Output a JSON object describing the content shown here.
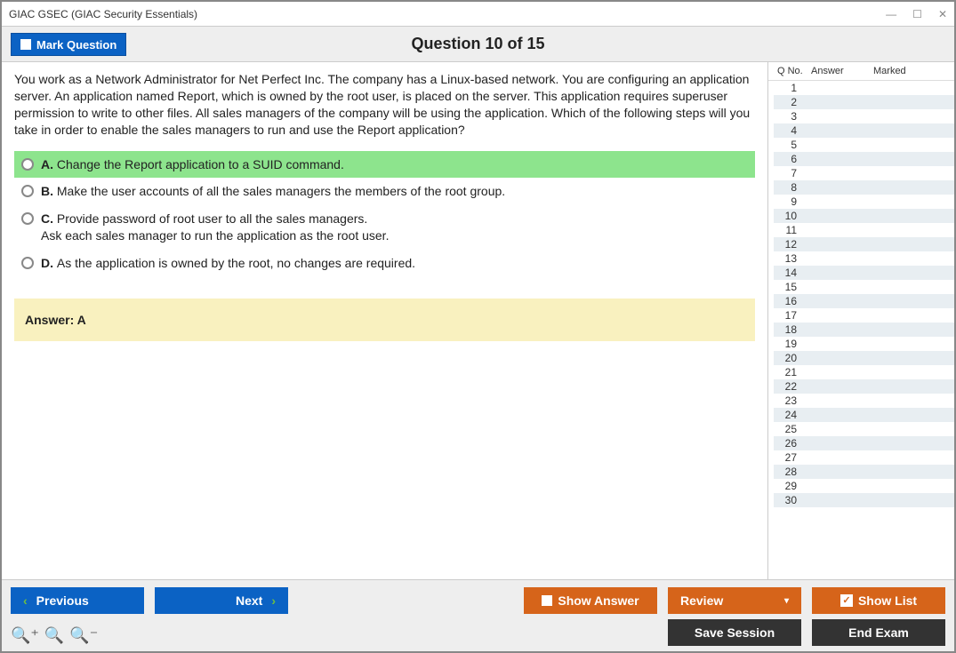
{
  "window": {
    "title": "GIAC GSEC (GIAC Security Essentials)"
  },
  "header": {
    "mark_label": "Mark Question",
    "question_title": "Question 10 of 15"
  },
  "question": {
    "text": "You work as a Network Administrator for Net Perfect Inc. The company has a Linux-based network. You are configuring an application server. An application named Report, which is owned by the root user, is placed on the server. This application requires superuser permission to write to other files. All sales managers of the company will be using the application. Which of the following steps will you take in order to enable the sales managers to run and use the Report application?",
    "options": [
      {
        "letter": "A.",
        "text": "Change the Report application to a SUID command.",
        "correct": true
      },
      {
        "letter": "B.",
        "text": "Make the user accounts of all the sales managers the members of the root group.",
        "correct": false
      },
      {
        "letter": "C.",
        "text": "Provide password of root user to all the sales managers.\nAsk each sales manager to run the application as the root user.",
        "correct": false
      },
      {
        "letter": "D.",
        "text": "As the application is owned by the root, no changes are required.",
        "correct": false
      }
    ],
    "answer_label": "Answer: A"
  },
  "sidebar": {
    "col_qno": "Q No.",
    "col_answer": "Answer",
    "col_marked": "Marked",
    "count": 30
  },
  "footer": {
    "previous": "Previous",
    "next": "Next",
    "show_answer": "Show Answer",
    "review": "Review",
    "show_list": "Show List",
    "save_session": "Save Session",
    "end_exam": "End Exam"
  }
}
